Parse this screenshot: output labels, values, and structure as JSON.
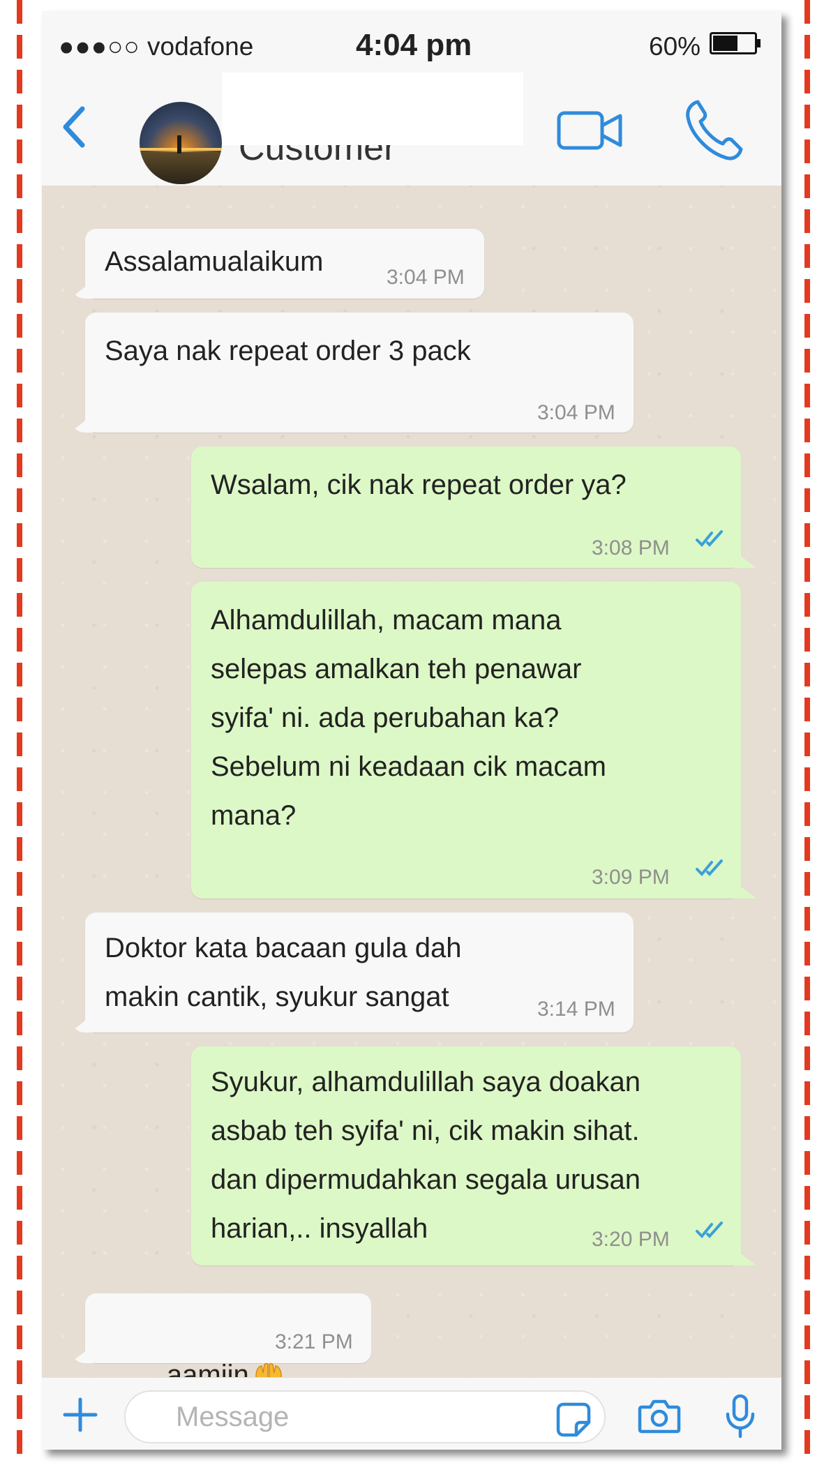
{
  "colors": {
    "accent": "#2f8bdb",
    "incoming_bubble": "#f8f8f8",
    "outgoing_bubble": "#dcf8c6",
    "chat_background": "#e6ddd3",
    "read_ticks": "#3ba0d8",
    "frame_dash": "#e33a1f"
  },
  "status_bar": {
    "signal": "●●●○○",
    "carrier": "vodafone",
    "time": "4:04 pm",
    "battery_percent": "60%",
    "battery_level": 0.6
  },
  "header": {
    "contact_name": "Customer",
    "icons": [
      "chevron-left-icon",
      "video-call-icon",
      "phone-call-icon"
    ]
  },
  "messages": [
    {
      "direction": "incoming",
      "text": "Assalamualaikum",
      "time": "3:04 PM"
    },
    {
      "direction": "incoming",
      "text": "Saya nak repeat order 3 pack",
      "time": "3:04 PM"
    },
    {
      "direction": "outgoing",
      "text": "Wsalam, cik nak repeat order ya?",
      "time": "3:08 PM",
      "status": "read"
    },
    {
      "direction": "outgoing",
      "text": "Alhamdulillah, macam mana\nselepas amalkan teh penawar\nsyifa' ni. ada perubahan ka?\nSebelum ni keadaan cik macam\nmana?",
      "time": "3:09 PM",
      "status": "read"
    },
    {
      "direction": "incoming",
      "text": "Doktor kata bacaan gula dah\nmakin cantik, syukur sangat",
      "time": "3:14 PM"
    },
    {
      "direction": "outgoing",
      "text": "Syukur, alhamdulillah saya doakan\nasbab teh syifa' ni, cik makin sihat.\ndan dipermudahkan segala urusan\nharian,.. insyallah",
      "time": "3:20 PM",
      "status": "read"
    },
    {
      "direction": "incoming",
      "text": "aamiin",
      "emoji": "open-hands-emoji",
      "time": "3:21 PM"
    }
  ],
  "input_bar": {
    "placeholder": "Message",
    "value": "",
    "icons": [
      "plus-icon",
      "sticker-icon",
      "camera-icon",
      "microphone-icon"
    ]
  }
}
